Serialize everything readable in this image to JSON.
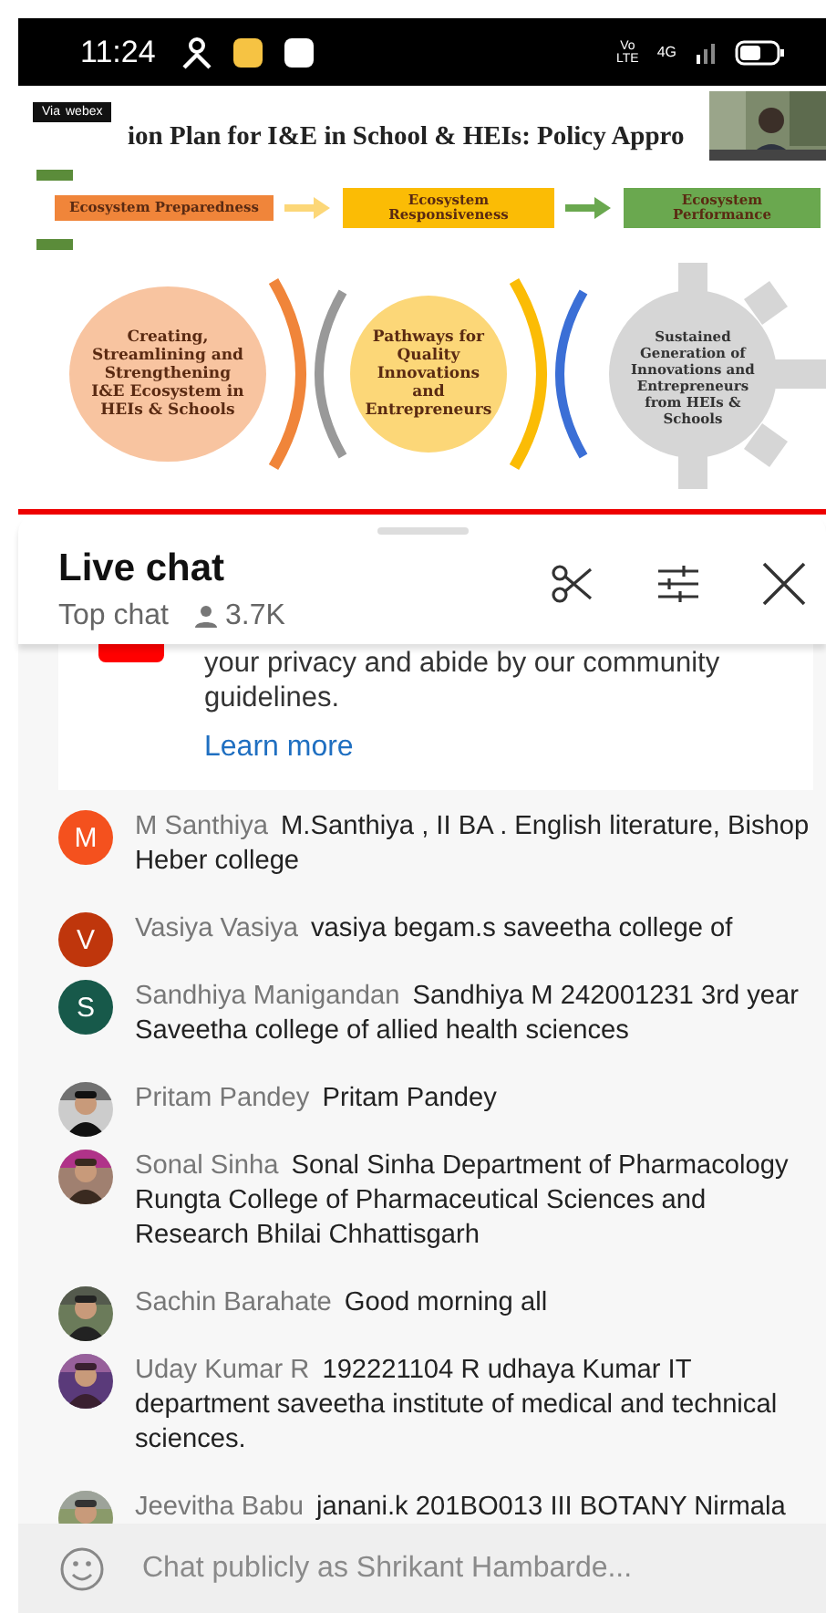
{
  "status_bar": {
    "time": "11:24",
    "volte": [
      "Vo",
      "LTE"
    ],
    "network": "4G"
  },
  "video": {
    "badge": [
      "Via",
      "webex"
    ],
    "slide": {
      "title": "ion Plan for I&E in School & HEIs: Policy Appro",
      "goals": [
        {
          "label": "Ecosystem Preparedness",
          "color": "#f0853a"
        },
        {
          "label": "Ecosystem Responsiveness",
          "color": "#fbbc05"
        },
        {
          "label": "Ecosystem Performance",
          "color": "#6aa84f"
        }
      ],
      "objectives": [
        {
          "kind": "ellipse",
          "text": "Creating, Streamlining and Strengthening I&E Ecosystem in HEIs & Schools",
          "color": "#f8c4a0"
        },
        {
          "kind": "ellipse",
          "text": "Pathways for Quality Innovations and Entrepreneurs",
          "color": "#fcd778"
        },
        {
          "kind": "gear",
          "text": "Sustained Generation of Innovations and Entrepreneurs from HEIs & Schools",
          "color": "#d6d6d6"
        }
      ]
    },
    "thumbnail": {
      "kind": "picture"
    },
    "progress": {
      "level": 1
    }
  },
  "chat": {
    "title": "Live chat",
    "mode": "Top chat",
    "viewers": "3.7K",
    "notice": {
      "text": "your privacy and abide by our community guidelines.",
      "link": "Learn more"
    },
    "messages": [
      {
        "author": "M Santhiya",
        "text": "M.Santhiya , II BA . English literature, Bishop Heber college",
        "avatar": {
          "kind": "letter",
          "letter": "M",
          "color": "#f4511e"
        }
      },
      {
        "author": "Vasiya Vasiya",
        "text": "vasiya begam.s saveetha college of",
        "avatar": {
          "kind": "letter",
          "letter": "V",
          "color": "#bf360c"
        }
      },
      {
        "author": "Sandhiya Manigandan",
        "text": "Sandhiya M 242001231 3rd year Saveetha college of allied health sciences",
        "avatar": {
          "kind": "letter",
          "letter": "S",
          "color": "#17594a"
        }
      },
      {
        "author": "Pritam Pandey",
        "text": "Pritam Pandey",
        "avatar": {
          "kind": "picture"
        }
      },
      {
        "author": "Sonal Sinha",
        "text": "Sonal Sinha Department of Pharmacology Rungta College of Pharmaceutical Sciences and Research Bhilai Chhattisgarh",
        "avatar": {
          "kind": "picture"
        }
      },
      {
        "author": "Sachin Barahate",
        "text": "Good morning all",
        "avatar": {
          "kind": "picture"
        }
      },
      {
        "author": "Uday Kumar R",
        "text": "192221104 R udhaya Kumar IT department saveetha institute of medical and technical sciences.",
        "avatar": {
          "kind": "picture"
        }
      },
      {
        "author": "Jeevitha Babu",
        "text": "janani.k 201BO013 III BOTANY Nirmala",
        "avatar": {
          "kind": "picture"
        }
      }
    ],
    "input": {
      "placeholder": "Chat publicly as Shrikant Hambarde..."
    }
  }
}
